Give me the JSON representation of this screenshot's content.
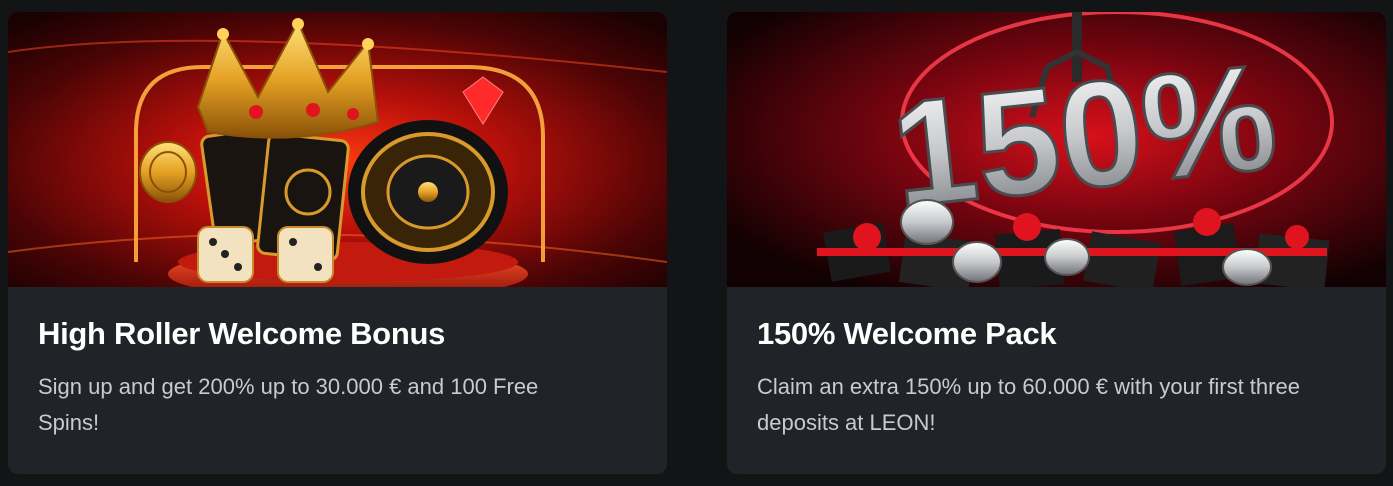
{
  "promos": [
    {
      "title": "High Roller Welcome Bonus",
      "description": "Sign up and get 200% up to 30.000 € and 100 Free Spins!",
      "banner_icon": "crown-roulette-illustration"
    },
    {
      "title": "150% Welcome Pack",
      "description": "Claim an extra 150% up to 60.000 € with your first three deposits at LEON!",
      "banner_icon": "150-percent-gifts-illustration",
      "banner_text": "150%"
    }
  ],
  "colors": {
    "page_bg": "#121416",
    "card_bg": "#202327",
    "title": "#ffffff",
    "description": "#c7cbd1",
    "accent_red": "#e0141e",
    "accent_gold": "#f2b230"
  }
}
